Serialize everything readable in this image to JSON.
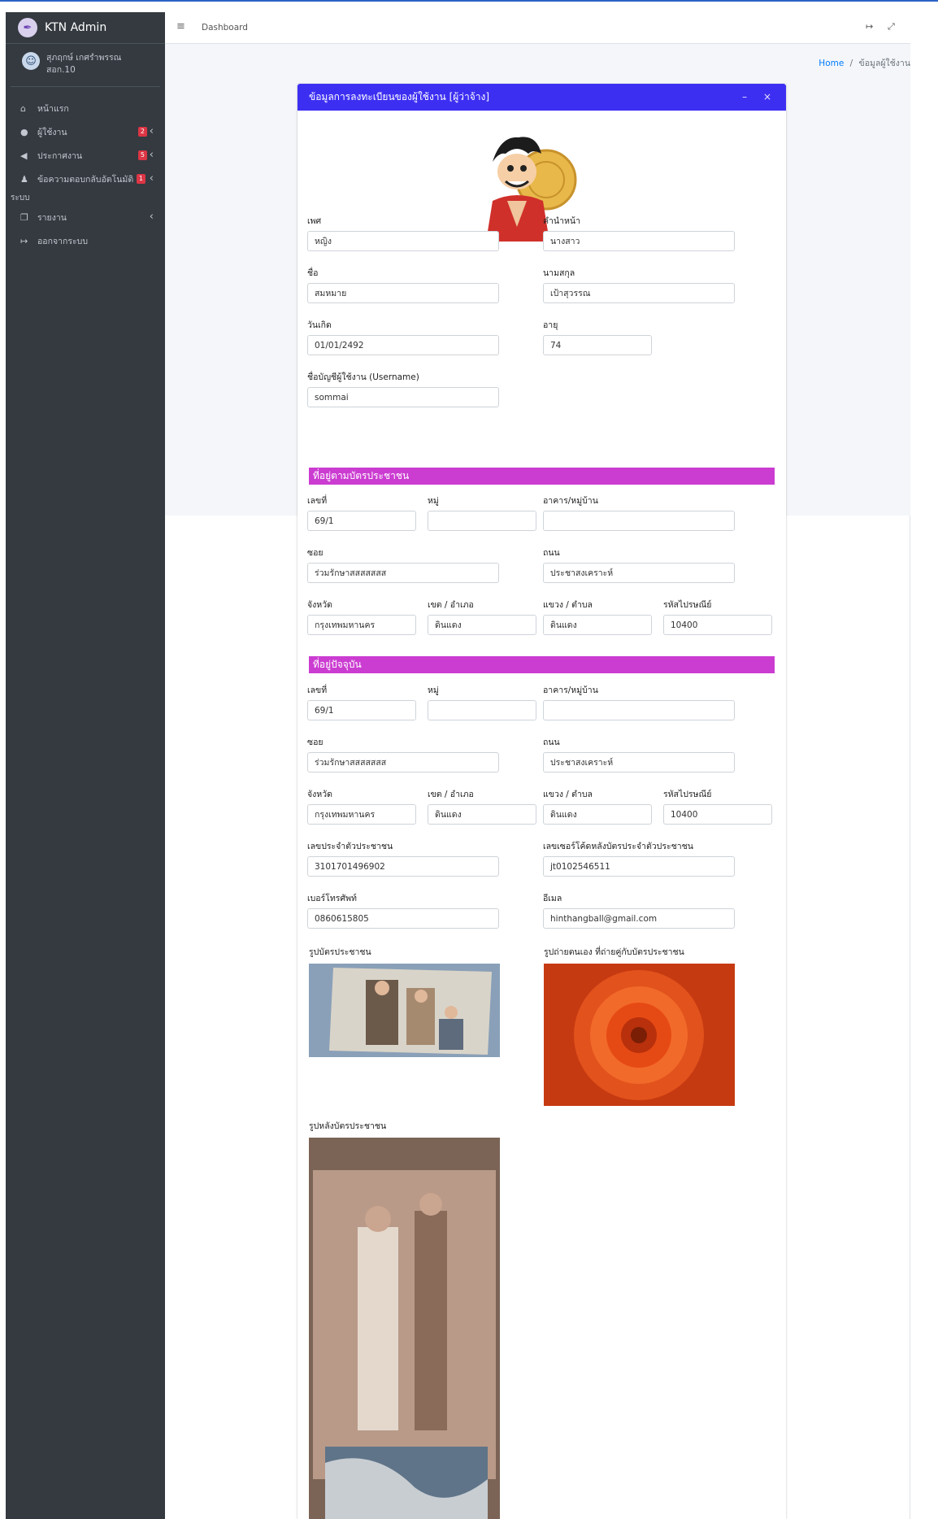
{
  "brand": {
    "name": "KTN Admin"
  },
  "user": {
    "name_line1": "สุภฤกษ์ เกศรำพรรณ",
    "name_line2": "สอก.10"
  },
  "nav": {
    "home": "หน้าแรก",
    "users": "ผู้ใช้งาน",
    "users_badge": "2",
    "announce": "ประกาศงาน",
    "announce_badge": "5",
    "feedback": "ข้อความตอบกลับอัตโนมัติ",
    "feedback_badge": "1",
    "system_header": "ระบบ",
    "report": "รายงาน",
    "logout": "ออกจากระบบ"
  },
  "topbar": {
    "dashboard": "Dashboard"
  },
  "breadcrumb": {
    "home": "Home",
    "sep": "/",
    "current": "ข้อมูลผู้ใช้งาน"
  },
  "card": {
    "title": "ข้อมูลการลงทะเบียนของผู้ใช้งาน [ผู้ว่าจ้าง]",
    "tools": "– ×"
  },
  "form": {
    "gender_label": "เพศ",
    "gender": "หญิง",
    "prefix_label": "คำนำหน้า",
    "prefix": "นางสาว",
    "fname_label": "ชื่อ",
    "fname": "สมหมาย",
    "lname_label": "นามสกุล",
    "lname": "เป้าสุวรรณ",
    "birth_label": "วันเกิด",
    "birth": "01/01/2492",
    "age_label": "อายุ",
    "age": "74",
    "username_label": "ชื่อบัญชีผู้ใช้งาน (Username)",
    "username": "sommai"
  },
  "addr_card": {
    "title": "ที่อยู่ตามบัตรประชาชน",
    "no_label": "เลขที่",
    "no": "69/1",
    "moo_label": "หมู่",
    "moo": "",
    "building_label": "อาคาร/หมู่บ้าน",
    "building": "",
    "soi_label": "ซอย",
    "soi": "ร่วมรักษาสสสสสสส",
    "road_label": "ถนน",
    "road": "ประชาสงเคราะห์",
    "province_label": "จังหวัด",
    "province": "กรุงเทพมหานคร",
    "district_label": "เขต / อำเภอ",
    "district": "ดินแดง",
    "subdistrict_label": "แขวง / ตำบล",
    "subdistrict": "ดินแดง",
    "zip_label": "รหัสไปรษณีย์",
    "zip": "10400"
  },
  "addr_now": {
    "title": "ที่อยู่ปัจจุบัน",
    "no_label": "เลขที่",
    "no": "69/1",
    "moo_label": "หมู่",
    "moo": "",
    "building_label": "อาคาร/หมู่บ้าน",
    "building": "",
    "soi_label": "ซอย",
    "soi": "ร่วมรักษาสสสสสสส",
    "road_label": "ถนน",
    "road": "ประชาสงเคราะห์",
    "province_label": "จังหวัด",
    "province": "กรุงเทพมหานคร",
    "district_label": "เขต / อำเภอ",
    "district": "ดินแดง",
    "subdistrict_label": "แขวง / ตำบล",
    "subdistrict": "ดินแดง",
    "zip_label": "รหัสไปรษณีย์",
    "zip": "10400"
  },
  "ids": {
    "idcard_label": "เลขประจำตัวประชาชน",
    "idcard": "3101701496902",
    "laser_label": "เลขเซอร์โค้ดหลังบัตรประจำตัวประชาชน",
    "laser": "jt0102546511",
    "phone_label": "เบอร์โทรศัพท์",
    "phone": "0860615805",
    "email_label": "อีเมล",
    "email": "hinthangball@gmail.com"
  },
  "photos": {
    "idcard_photo_label": "รูปบัตรประชาชน",
    "selfie_label": "รูปถ่ายตนเอง ที่ถ่ายคู่กับบัตรประชาชน",
    "back_label": "รูปหลังบัตรประชาชน"
  },
  "colors": {
    "header": "#3d2ff2",
    "section": "#cb3cd1",
    "sidebar": "#343a40",
    "badge": "#dc3545"
  }
}
